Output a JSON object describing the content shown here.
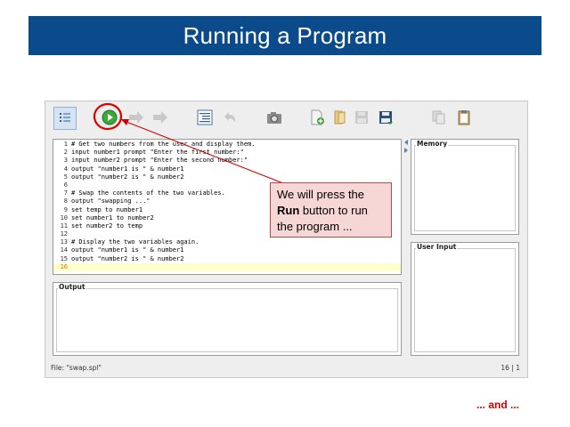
{
  "slide": {
    "title": "Running a Program",
    "footer": "... and ..."
  },
  "toolbar": {
    "buttons": [
      {
        "name": "toggle-view-icon",
        "active": true
      },
      {
        "name": "run-icon",
        "highlighted": true
      },
      {
        "name": "step-icon",
        "enabled": false
      },
      {
        "name": "step-over-icon",
        "enabled": false
      },
      {
        "name": "outline-icon",
        "enabled": true
      },
      {
        "name": "undo-icon",
        "enabled": false
      },
      {
        "name": "camera-icon",
        "enabled": true
      },
      {
        "name": "new-file-icon",
        "enabled": true
      },
      {
        "name": "open-file-icon",
        "enabled": true
      },
      {
        "name": "save-disabled-icon",
        "enabled": false
      },
      {
        "name": "save-icon",
        "enabled": true
      },
      {
        "name": "copy-icon",
        "enabled": false
      },
      {
        "name": "paste-icon",
        "enabled": true
      }
    ]
  },
  "editor": {
    "current_line": 16,
    "lines": [
      {
        "n": "1",
        "text": "# Get two numbers from the user and display them."
      },
      {
        "n": "2",
        "text": "input number1 prompt \"Enter the first number:\""
      },
      {
        "n": "3",
        "text": "input number2 prompt \"Enter the second number:\""
      },
      {
        "n": "4",
        "text": "output \"number1 is \" & number1"
      },
      {
        "n": "5",
        "text": "output \"number2 is \" & number2"
      },
      {
        "n": "6",
        "text": ""
      },
      {
        "n": "7",
        "text": "# Swap the contents of the two variables."
      },
      {
        "n": "8",
        "text": "output \"swapping ...\""
      },
      {
        "n": "9",
        "text": "set temp to number1"
      },
      {
        "n": "10",
        "text": "set number1 to number2"
      },
      {
        "n": "11",
        "text": "set number2 to temp"
      },
      {
        "n": "12",
        "text": ""
      },
      {
        "n": "13",
        "text": "# Display the two variables again."
      },
      {
        "n": "14",
        "text": "output \"number1 is \" & number1"
      },
      {
        "n": "15",
        "text": "output \"number2 is \" & number2"
      },
      {
        "n": "16",
        "text": ""
      }
    ]
  },
  "panes": {
    "output_title": "Output",
    "memory_title": "Memory",
    "user_input_title": "User Input"
  },
  "status": {
    "file": "File: \"swap.spl\"",
    "position": "16 | 1"
  },
  "callout": {
    "pre": "We will press the",
    "bold": "Run",
    "post": "button to run the program ..."
  },
  "colors": {
    "banner": "#0b4a8b",
    "callout_fill": "#f7d6d6",
    "callout_border": "#c04848",
    "highlight_ring": "#e00000",
    "run_green": "#3aa83a",
    "footer_text": "#d00000"
  }
}
